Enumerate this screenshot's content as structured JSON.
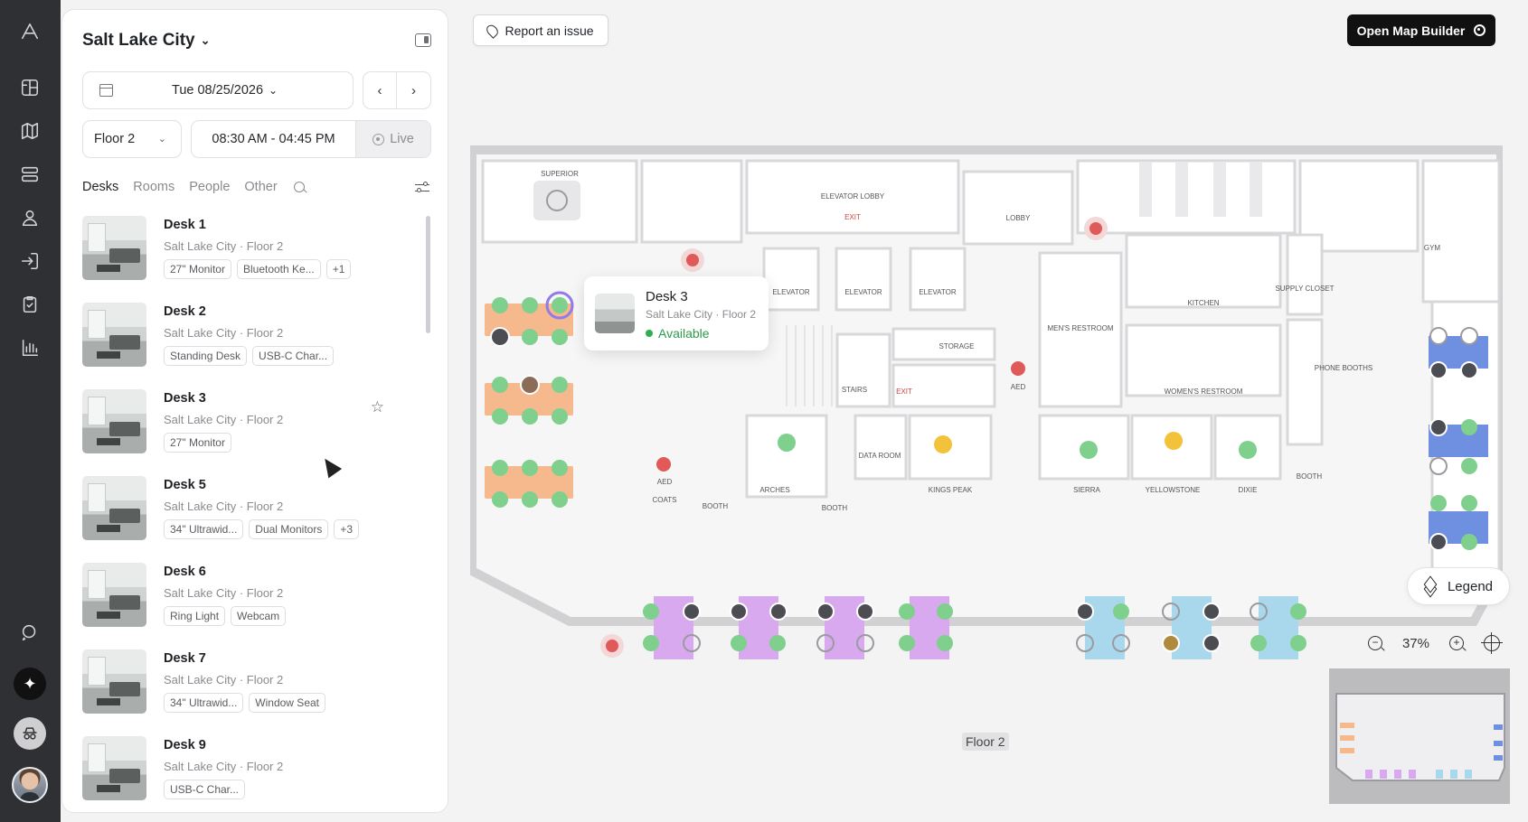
{
  "location": {
    "title": "Salt Lake City"
  },
  "date": {
    "value": "Tue 08/25/2026"
  },
  "floor_select": {
    "value": "Floor 2"
  },
  "time_range": {
    "value": "08:30 AM - 04:45 PM",
    "live_label": "Live"
  },
  "tabs": [
    {
      "label": "Desks"
    },
    {
      "label": "Rooms"
    },
    {
      "label": "People"
    },
    {
      "label": "Other"
    }
  ],
  "desks": [
    {
      "name": "Desk 1",
      "subtitle": "Salt Lake City · Floor 2",
      "chips": [
        "27\" Monitor",
        "Bluetooth Ke..."
      ],
      "more": "+1"
    },
    {
      "name": "Desk 2",
      "subtitle": "Salt Lake City · Floor 2",
      "chips": [
        "Standing Desk",
        "USB-C Char..."
      ],
      "more": ""
    },
    {
      "name": "Desk 3",
      "subtitle": "Salt Lake City · Floor 2",
      "chips": [
        "27\" Monitor"
      ],
      "more": ""
    },
    {
      "name": "Desk 5",
      "subtitle": "Salt Lake City · Floor 2",
      "chips": [
        "34\" Ultrawid...",
        "Dual Monitors"
      ],
      "more": "+3"
    },
    {
      "name": "Desk 6",
      "subtitle": "Salt Lake City · Floor 2",
      "chips": [
        "Ring Light",
        "Webcam"
      ],
      "more": ""
    },
    {
      "name": "Desk 7",
      "subtitle": "Salt Lake City · Floor 2",
      "chips": [
        "34\" Ultrawid...",
        "Window Seat"
      ],
      "more": ""
    },
    {
      "name": "Desk 9",
      "subtitle": "Salt Lake City · Floor 2",
      "chips": [
        "USB-C Char..."
      ],
      "more": ""
    }
  ],
  "toolbar": {
    "report_label": "Report an issue",
    "builder_label": "Open Map Builder"
  },
  "popup": {
    "title": "Desk 3",
    "subtitle": "Salt Lake City · Floor 2",
    "status": "Available",
    "status_color": "#2e9a4a"
  },
  "legend": {
    "label": "Legend"
  },
  "zoom": {
    "level": "37%"
  },
  "floor_label": "Floor 2",
  "map_labels": {
    "superior": "SUPERIOR",
    "elevator_lobby": "ELEVATOR LOBBY",
    "exit": "EXIT",
    "lobby": "LOBBY",
    "elevator": "ELEVATOR",
    "mens": "MEN'S RESTROOM",
    "kitchen": "KITCHEN",
    "supply": "SUPPLY CLOSET",
    "gym": "GYM",
    "storage": "STORAGE",
    "stairs": "STAIRS",
    "aed": "AED",
    "womens": "WOMEN'S RESTROOM",
    "phone": "PHONE BOOTHS",
    "arches": "ARCHES",
    "data_room": "DATA ROOM",
    "kings_peak": "KINGS PEAK",
    "sierra": "SIERRA",
    "yellowstone": "YELLOWSTONE",
    "dixie": "DIXIE",
    "booth": "BOOTH",
    "coats": "COATS"
  },
  "colors": {
    "accent": "#111111",
    "available": "#7fd08d",
    "orange_zone": "#f6b88d",
    "purple_zone": "#d9a9ef",
    "blue_zone": "#a9d8ec",
    "navy_zone": "#6f8fe0",
    "booked": "#f3c23b"
  }
}
